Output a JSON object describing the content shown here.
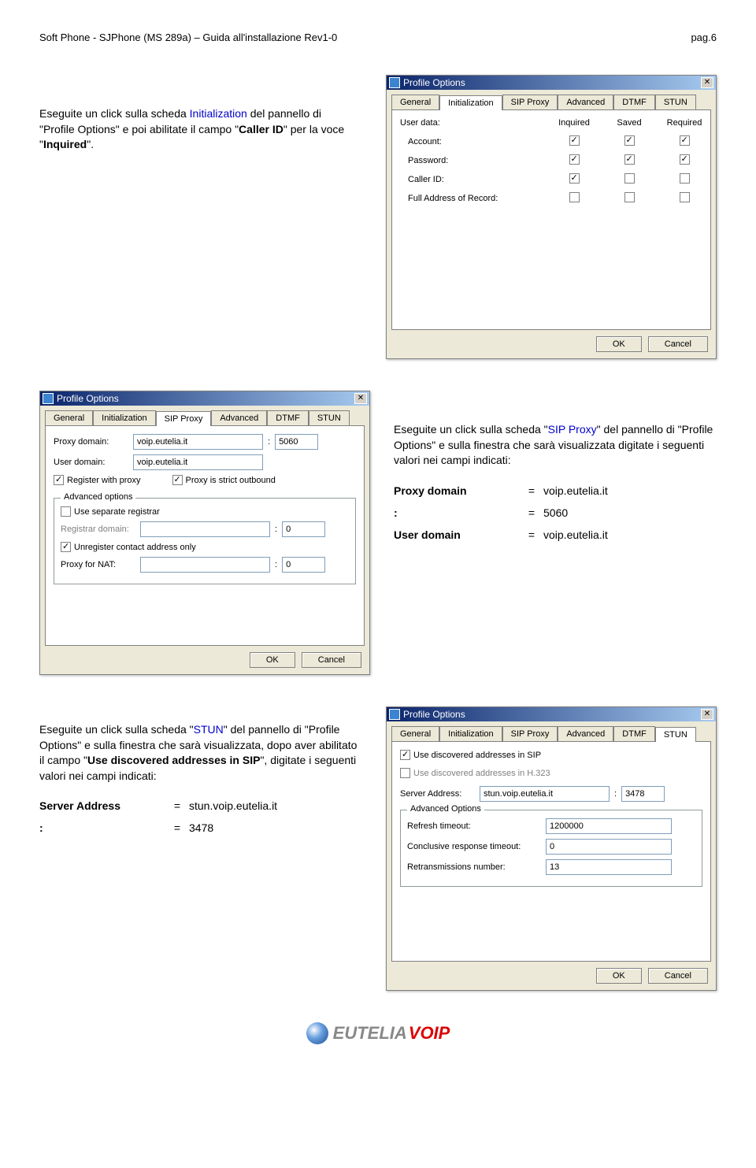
{
  "header": {
    "left": "Soft Phone - SJPhone (MS 289a) – Guida all'installazione Rev1-0",
    "right": "pag.6"
  },
  "intro1": {
    "pre": "Eseguite un click sulla scheda ",
    "link": "Initialization",
    "mid": " del pannello di \"Profile Options\" e poi abilitate il campo \"",
    "bold": "Caller ID",
    "post": "\" per la voce \"",
    "bold2": "Inquired",
    "post2": "\"."
  },
  "dialog1": {
    "title": "Profile Options",
    "tabs": [
      "General",
      "Initialization",
      "SIP Proxy",
      "Advanced",
      "DTMF",
      "STUN"
    ],
    "activeTab": 1,
    "userdata": "User data:",
    "cols": [
      "Inquired",
      "Saved",
      "Required"
    ],
    "rows": [
      {
        "label": "Account:",
        "checks": [
          true,
          true,
          true
        ]
      },
      {
        "label": "Password:",
        "checks": [
          true,
          true,
          true
        ]
      },
      {
        "label": "Caller ID:",
        "checks": [
          true,
          false,
          false
        ]
      },
      {
        "label": "Full Address of Record:",
        "checks": [
          false,
          false,
          false
        ]
      }
    ],
    "ok": "OK",
    "cancel": "Cancel"
  },
  "intro2": {
    "pre": "Eseguite un click sulla scheda \"",
    "link": "SIP Proxy",
    "post": "\" del pannello di \"Profile Options\" e sulla finestra che sarà visualizzata digitate i seguenti valori nei campi indicati:"
  },
  "params2": [
    {
      "label": "Proxy domain",
      "eq": "=",
      "val": "voip.eutelia.it"
    },
    {
      "label": ":",
      "eq": "=",
      "val": "5060"
    },
    {
      "label": "User domain",
      "eq": "=",
      "val": "voip.eutelia.it"
    }
  ],
  "dialog2": {
    "title": "Profile Options",
    "tabs": [
      "General",
      "Initialization",
      "SIP Proxy",
      "Advanced",
      "DTMF",
      "STUN"
    ],
    "activeTab": 2,
    "proxyDomainLabel": "Proxy domain:",
    "proxyDomain": "voip.eutelia.it",
    "proxyPortLabel": ":",
    "proxyPort": "5060",
    "userDomainLabel": "User domain:",
    "userDomain": "voip.eutelia.it",
    "registerWithProxy": "Register with proxy",
    "strictOutbound": "Proxy is strict outbound",
    "advLegend": "Advanced options",
    "useSeparate": "Use separate registrar",
    "registrarDomainLabel": "Registrar domain:",
    "registrarDomain": "",
    "registrarPortLabel": ":",
    "registrarPort": "0",
    "unregister": "Unregister contact address only",
    "proxyForNatLabel": "Proxy for NAT:",
    "proxyForNat": "",
    "proxyForNatPortLabel": ":",
    "proxyForNatPort": "0",
    "ok": "OK",
    "cancel": "Cancel"
  },
  "intro3": {
    "pre": "Eseguite un click sulla scheda \"",
    "link": "STUN",
    "mid": "\" del pannello di \"Profile Options\" e sulla finestra che sarà visualizzata, dopo aver abilitato il campo \"",
    "bold": "Use discovered addresses in SIP",
    "post": "\", digitate i seguenti valori nei campi indicati:"
  },
  "params3": [
    {
      "label": "Server Address",
      "eq": "=",
      "val": "stun.voip.eutelia.it"
    },
    {
      "label": ":",
      "eq": "=",
      "val": "3478"
    }
  ],
  "dialog3": {
    "title": "Profile Options",
    "tabs": [
      "General",
      "Initialization",
      "SIP Proxy",
      "Advanced",
      "DTMF",
      "STUN"
    ],
    "activeTab": 5,
    "useSip": "Use discovered addresses in SIP",
    "useH323": "Use discovered addresses in H.323",
    "serverAddressLabel": "Server Address:",
    "serverAddress": "stun.voip.eutelia.it",
    "serverPortLabel": ":",
    "serverPort": "3478",
    "advLegend": "Advanced Options",
    "refreshLabel": "Refresh timeout:",
    "refresh": "1200000",
    "conclusiveLabel": "Conclusive response timeout:",
    "conclusive": "0",
    "retransLabel": "Retransmissions number:",
    "retrans": "13",
    "ok": "OK",
    "cancel": "Cancel"
  },
  "logo": {
    "eu": "EUTELIA",
    "voip": "VOIP"
  }
}
